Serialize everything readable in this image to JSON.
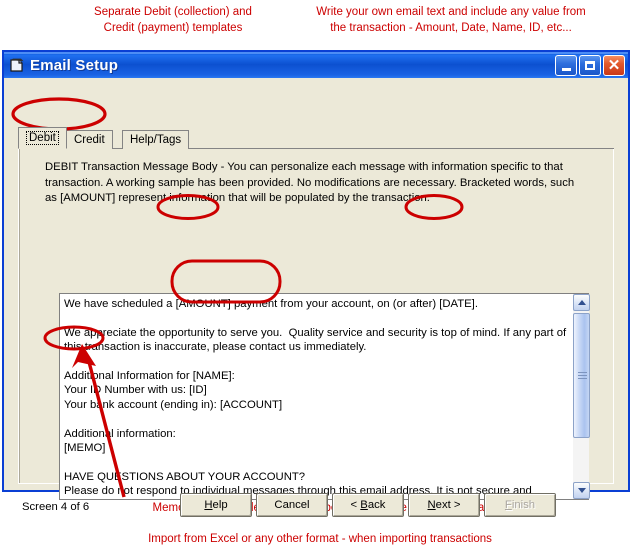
{
  "annotations": {
    "top_left": "Separate Debit (collection) and\nCredit (payment) templates",
    "top_right": "Write your own email text and include any value from\nthe transaction - Amount, Date, Name, ID, etc...",
    "bottom_1": "Memo Field - Include invoice numbers, remittance and other data.",
    "bottom_2": "Import from Excel or any other format - when importing transactions",
    "color": "#cc0000"
  },
  "window": {
    "title": "Email Setup",
    "icon": "window-document-icon",
    "controls": {
      "minimize": "minimize-icon",
      "maximize": "maximize-icon",
      "close": "close-icon"
    },
    "titlebar_color": "#0c50d0",
    "border_color": "#0a3fd4",
    "client_color": "#ece9d8"
  },
  "tabs": [
    {
      "label": "Debit",
      "active": true
    },
    {
      "label": "Credit",
      "active": false
    },
    {
      "label": "Help/Tags",
      "active": false
    }
  ],
  "panel": {
    "description": "DEBIT Transaction Message Body - You can personalize each message with information specific to that transaction.  A working sample has been provided.  No modifications are necessary.  Bracketed words, such as [AMOUNT] represent information that will be populated by the transaction."
  },
  "editor": {
    "value": "We have scheduled a [AMOUNT] payment from your account, on (or after) [DATE].\n\nWe appreciate the opportunity to serve you.  Quality service and security is top of mind. If any part of\nthis transaction is inaccurate, please contact us immediately.\n\nAdditional Information for [NAME]:\nYour ID Number with us: [ID]\nYour bank account (ending in): [ACCOUNT]\n\nAdditional information:\n[MEMO]\n\nHAVE QUESTIONS ABOUT YOUR ACCOUNT?\nPlease do not respond to individual messages through this email address. It is not secure and should\nnot be used for account-related questions, because we are unable to verify the identity of the sender.",
    "scrollbar": {
      "up_icon": "scroll-up-arrow-icon",
      "down_icon": "scroll-down-arrow-icon",
      "grip_icon": "scrollbar-grip-icon"
    }
  },
  "footer": {
    "screen_label": "Screen 4 of 6",
    "buttons": [
      {
        "label": "Help",
        "accel": "H",
        "disabled": false
      },
      {
        "label": "Cancel",
        "accel": "",
        "disabled": false
      },
      {
        "label": "< Back",
        "accel": "B",
        "disabled": false
      },
      {
        "label": "Next >",
        "accel": "N",
        "disabled": false
      },
      {
        "label": "Finish",
        "accel": "F",
        "disabled": true
      }
    ]
  }
}
